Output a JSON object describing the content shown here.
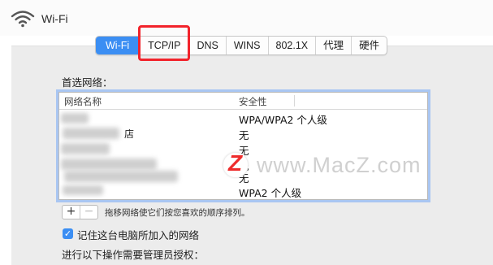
{
  "window": {
    "title": "Wi-Fi"
  },
  "tabs": [
    {
      "label": "Wi-Fi",
      "active": true
    },
    {
      "label": "TCP/IP",
      "active": false
    },
    {
      "label": "DNS",
      "active": false
    },
    {
      "label": "WINS",
      "active": false
    },
    {
      "label": "802.1X",
      "active": false
    },
    {
      "label": "代理",
      "active": false
    },
    {
      "label": "硬件",
      "active": false
    }
  ],
  "preferred_networks": {
    "label": "首选网络：",
    "columns": {
      "name": "网络名称",
      "security": "安全性"
    },
    "rows": [
      {
        "name": "",
        "security": "WPA/WPA2 个人级"
      },
      {
        "name": "店",
        "security": "无"
      },
      {
        "name": "",
        "security": "无"
      },
      {
        "name": "",
        "security": "无"
      },
      {
        "name": "",
        "security": "无"
      },
      {
        "name": "",
        "security": "WPA2 个人级"
      }
    ]
  },
  "buttons": {
    "add": "+",
    "remove": "−"
  },
  "hint": "拖移网络使它们按您喜欢的顺序排列。",
  "remember_networks": {
    "checked": true,
    "label": "记住这台电脑所加入的网络"
  },
  "admin_section": {
    "label": "进行以下操作需要管理员授权："
  },
  "watermark": {
    "logo": "Z",
    "text": "www.MacZ.com"
  },
  "colors": {
    "accent": "#3b8ef3",
    "highlight": "#f2232b"
  }
}
